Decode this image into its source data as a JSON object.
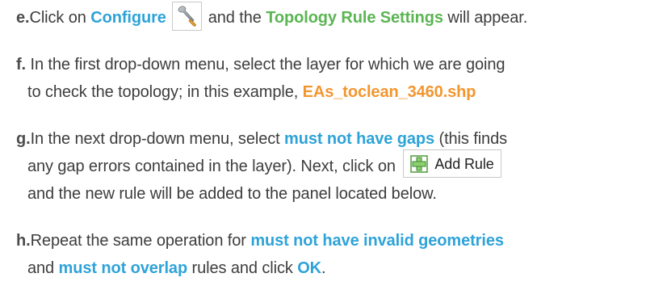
{
  "colors": {
    "accent_blue": "#2ea3d8",
    "accent_green": "#5ab552",
    "accent_orange": "#f3962f",
    "body_text": "#3d3d3d"
  },
  "steps": [
    {
      "letter": "e.",
      "t1": "Click on ",
      "kw1": "Configure",
      "icon": "wrench-icon",
      "t2": " and the ",
      "kw2": "Topology Rule Settings",
      "t3": " will appear."
    },
    {
      "letter": "f.",
      "line1": "In the first drop-down menu, select the layer for which we are going",
      "line2_text": "to check the topology; in this example, ",
      "kw1": "EAs_toclean_3460.shp"
    },
    {
      "letter": "g.",
      "t1": "In the next drop-down menu, select ",
      "kw1": "must not have gaps",
      "t2": " (this finds",
      "line2_text": "any gap errors contained in the layer). Next, click on ",
      "button_label": "Add Rule",
      "button_icon": "add-rule-plus-icon",
      "line3": "and the new rule will be added to the panel located below."
    },
    {
      "letter": "h.",
      "t1": "Repeat the same operation for ",
      "kw1": "must not have invalid geometries",
      "line2_t1": "and ",
      "kw2": "must not overlap",
      "line2_t2": " rules and click ",
      "kw3": "OK",
      "line2_t3": "."
    }
  ]
}
